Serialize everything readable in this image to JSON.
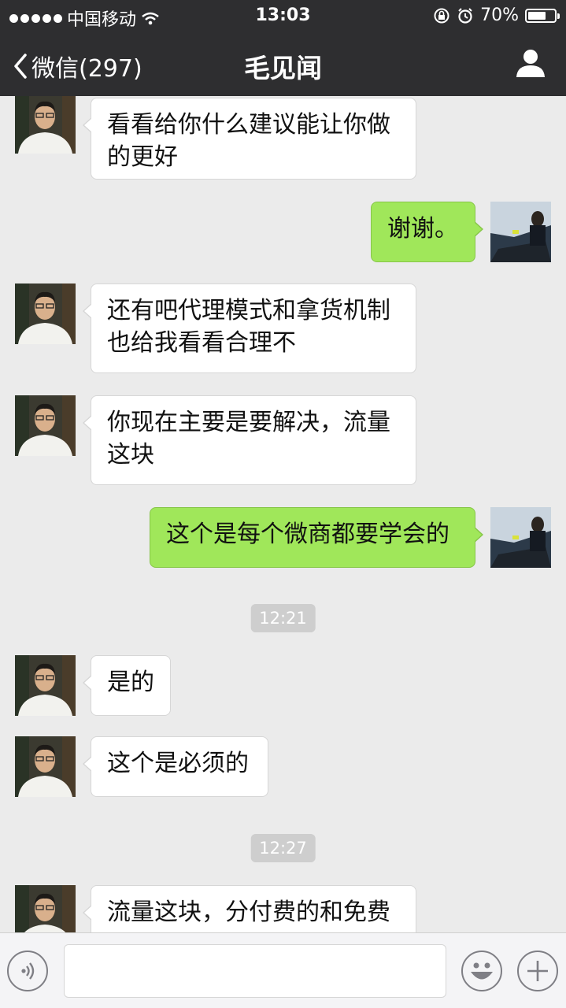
{
  "status_bar": {
    "carrier": "中国移动",
    "time": "13:03",
    "battery_text": "70%",
    "battery_level": 0.7,
    "icons": [
      "signal-dots-icon",
      "wifi-icon",
      "rotation-lock-icon",
      "alarm-icon",
      "battery-icon"
    ]
  },
  "nav": {
    "back_label": "微信(297)",
    "title": "毛见闻",
    "profile_icon": "person-icon"
  },
  "messages": [
    {
      "from": "other",
      "text": "看看给你什么建议能让你做\n的更好"
    },
    {
      "from": "me",
      "text": "谢谢。"
    },
    {
      "from": "other",
      "text": "还有吧代理模式和拿货机制\n也给我看看合理不"
    },
    {
      "from": "other",
      "text": "你现在主要是要解决，流量\n这块"
    },
    {
      "from": "me",
      "text": "这个是每个微商都要学会的"
    },
    {
      "type": "time",
      "text": "12:21"
    },
    {
      "from": "other",
      "text": "是的"
    },
    {
      "from": "other",
      "text": "这个是必须的"
    },
    {
      "type": "time",
      "text": "12:27"
    },
    {
      "from": "other",
      "text": "流量这块，分付费的和免费"
    }
  ],
  "input_bar": {
    "voice_icon": "voice-icon",
    "emoji_icon": "emoji-icon",
    "plus_icon": "plus-icon",
    "input_value": ""
  },
  "colors": {
    "nav_bg": "#2e2e30",
    "chat_bg": "#ebebeb",
    "my_bubble": "#a0e75a",
    "other_bubble": "#ffffff"
  }
}
